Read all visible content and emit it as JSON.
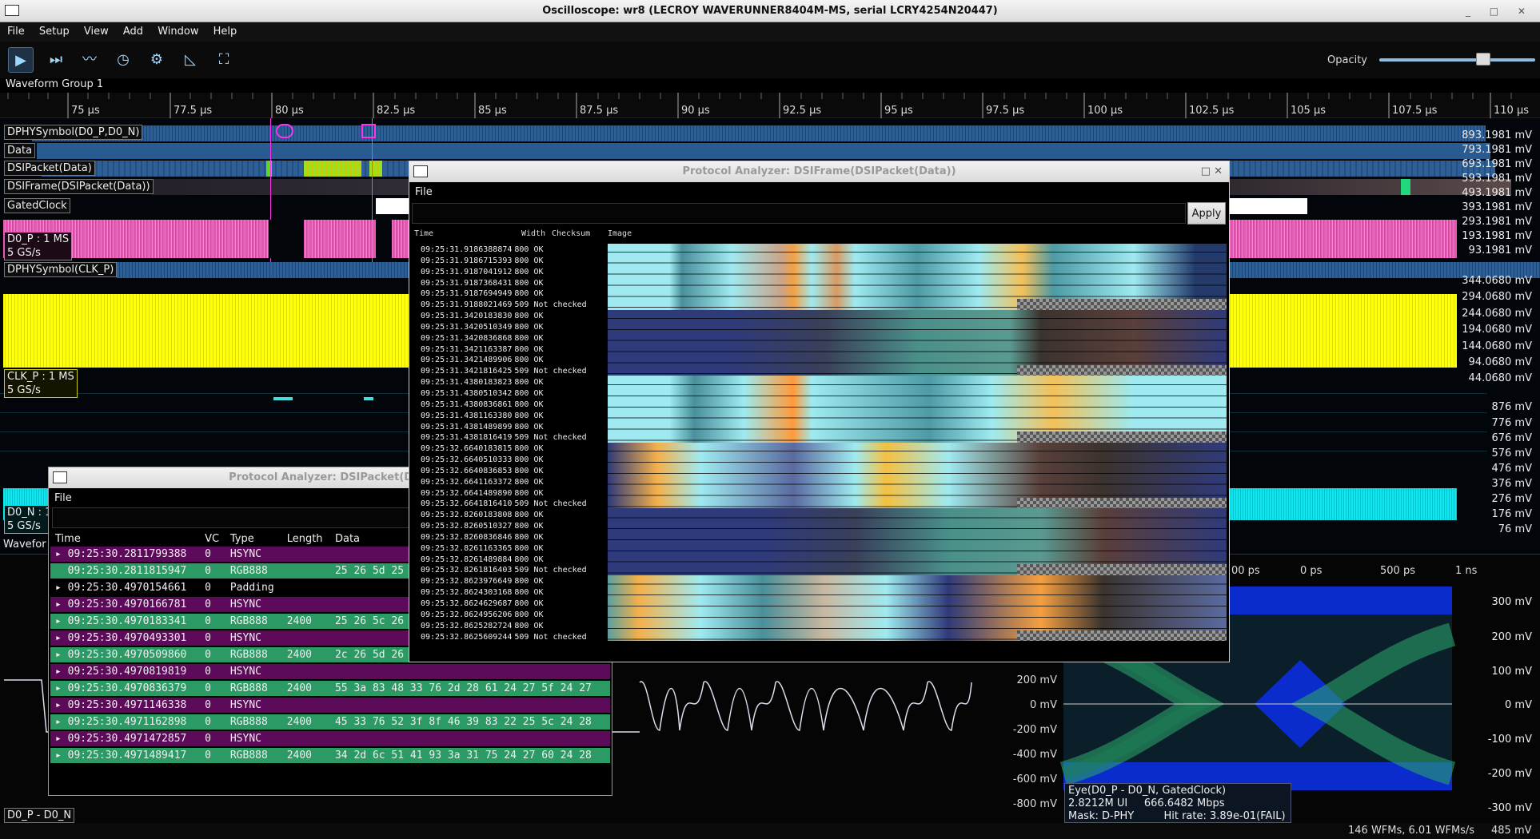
{
  "window": {
    "title": "Oscilloscope: wr8 (LECROY WAVERUNNER8404M-MS, serial LCRY4254N20447)"
  },
  "menu": [
    "File",
    "Setup",
    "View",
    "Add",
    "Window",
    "Help"
  ],
  "toolbar": {
    "buttons": [
      "play-icon",
      "step-icon",
      "waveform-icon",
      "history-icon",
      "settings-icon",
      "cursor-icon",
      "zoom-fit-icon"
    ],
    "opacity_label": "Opacity",
    "opacity_value": 0.7
  },
  "waveform_group": {
    "title": "Waveform Group 1"
  },
  "time_ruler": [
    "75 µs",
    "77.5 µs",
    "80 µs",
    "82.5 µs",
    "85 µs",
    "87.5 µs",
    "90 µs",
    "92.5 µs",
    "95 µs",
    "97.5 µs",
    "100 µs",
    "102.5 µs",
    "105 µs",
    "107.5 µs",
    "110 µs"
  ],
  "channels": {
    "dphy_symbol": "DPHYSymbol(D0_P,D0_N)",
    "data": "Data",
    "dsi_packet": "DSIPacket(Data)",
    "dsi_frame": "DSIFrame(DSIPacket(Data))",
    "gated_clock": "GatedClock",
    "d0p_line1": "D0_P : 1 MS",
    "d0p_line2": "5 GS/s",
    "dphy_clk": "DPHYSymbol(CLK_P)",
    "clkp_line1": "CLK_P : 1 MS",
    "clkp_line2": "5 GS/s",
    "d0n_line1": "D0_N : 1",
    "d0n_line2": "5 GS/s",
    "waveform_group2": "Wavefor",
    "diff": "D0_P - D0_N"
  },
  "scale_d0p": [
    "893.1981 mV",
    "793.1981 mV",
    "693.1981 mV",
    "593.1981 mV",
    "493.1981 mV",
    "393.1981 mV",
    "293.1981 mV",
    "193.1981 mV",
    "93.1981 mV"
  ],
  "scale_clkp": [
    "344.0680 mV",
    "294.0680 mV",
    "244.0680 mV",
    "194.0680 mV",
    "144.0680 mV",
    "94.0680 mV",
    "44.0680 mV"
  ],
  "scale_d0n": [
    "876 mV",
    "776 mV",
    "676 mV",
    "576 mV",
    "476 mV",
    "376 mV",
    "276 mV",
    "176 mV",
    "76 mV"
  ],
  "scale_diff": [
    "200 mV",
    "0 mV",
    "-200 mV",
    "-400 mV",
    "-600 mV",
    "-800 mV"
  ],
  "scale_eye": [
    "300 mV",
    "200 mV",
    "100 mV",
    "0 mV",
    "-100 mV",
    "-200 mV",
    "-300 mV"
  ],
  "eye_ruler": [
    "00 ps",
    "0 ps",
    "500 ps",
    "1 ns"
  ],
  "eye": {
    "title": "Eye(D0_P - D0_N, GatedClock)",
    "ui": "2.8212M UI",
    "rate": "666.6482 Mbps",
    "mask": "Mask: D-PHY",
    "hit_rate": "Hit rate: 3.89e-01(FAIL)"
  },
  "status": {
    "wfms": "146 WFMs, 6.01 WFMs/s",
    "mem": "485 mV"
  },
  "frame_analyzer": {
    "title": "Protocol Analyzer: DSIFrame(DSIPacket(Data))",
    "menu": "File",
    "filter_value": "",
    "apply": "Apply",
    "columns": [
      "Time",
      "Width",
      "Checksum",
      "Image"
    ],
    "rows": [
      [
        "09:25:31.9186388874",
        "800",
        "OK"
      ],
      [
        "09:25:31.9186715393",
        "800",
        "OK"
      ],
      [
        "09:25:31.9187041912",
        "800",
        "OK"
      ],
      [
        "09:25:31.9187368431",
        "800",
        "OK"
      ],
      [
        "09:25:31.9187694949",
        "800",
        "OK"
      ],
      [
        "09:25:31.9188021469",
        "509",
        "Not checked"
      ],
      [
        "09:25:31.3420183830",
        "800",
        "OK"
      ],
      [
        "09:25:31.3420510349",
        "800",
        "OK"
      ],
      [
        "09:25:31.3420836868",
        "800",
        "OK"
      ],
      [
        "09:25:31.3421163387",
        "800",
        "OK"
      ],
      [
        "09:25:31.3421489906",
        "800",
        "OK"
      ],
      [
        "09:25:31.3421816425",
        "509",
        "Not checked"
      ],
      [
        "09:25:31.4380183823",
        "800",
        "OK"
      ],
      [
        "09:25:31.4380510342",
        "800",
        "OK"
      ],
      [
        "09:25:31.4380836861",
        "800",
        "OK"
      ],
      [
        "09:25:31.4381163380",
        "800",
        "OK"
      ],
      [
        "09:25:31.4381489899",
        "800",
        "OK"
      ],
      [
        "09:25:31.4381816419",
        "509",
        "Not checked"
      ],
      [
        "09:25:32.6640183815",
        "800",
        "OK"
      ],
      [
        "09:25:32.6640510333",
        "800",
        "OK"
      ],
      [
        "09:25:32.6640836853",
        "800",
        "OK"
      ],
      [
        "09:25:32.6641163372",
        "800",
        "OK"
      ],
      [
        "09:25:32.6641489890",
        "800",
        "OK"
      ],
      [
        "09:25:32.6641816410",
        "509",
        "Not checked"
      ],
      [
        "09:25:32.8260183808",
        "800",
        "OK"
      ],
      [
        "09:25:32.8260510327",
        "800",
        "OK"
      ],
      [
        "09:25:32.8260836846",
        "800",
        "OK"
      ],
      [
        "09:25:32.8261163365",
        "800",
        "OK"
      ],
      [
        "09:25:32.8261489884",
        "800",
        "OK"
      ],
      [
        "09:25:32.8261816403",
        "509",
        "Not checked"
      ],
      [
        "09:25:32.8623976649",
        "800",
        "OK"
      ],
      [
        "09:25:32.8624303168",
        "800",
        "OK"
      ],
      [
        "09:25:32.8624629687",
        "800",
        "OK"
      ],
      [
        "09:25:32.8624956206",
        "800",
        "OK"
      ],
      [
        "09:25:32.8625282724",
        "800",
        "OK"
      ],
      [
        "09:25:32.8625609244",
        "509",
        "Not checked"
      ]
    ]
  },
  "packet_analyzer": {
    "title": "Protocol Analyzer: DSIPacket(Data",
    "menu": "File",
    "columns": [
      "Time",
      "VC",
      "Type",
      "Length",
      "Data"
    ],
    "rows": [
      {
        "time": "09:25:30.2811799388",
        "vc": "0",
        "type": "HSYNC",
        "length": "",
        "data": "",
        "kind": "hsync",
        "exp": true
      },
      {
        "time": "09:25:30.2811815947",
        "vc": "0",
        "type": "RGB888",
        "length": "",
        "data": "25 26 5d 25",
        "kind": "rgb",
        "exp": false
      },
      {
        "time": "09:25:30.4970154661",
        "vc": "0",
        "type": "Padding",
        "length": "",
        "data": "",
        "kind": "pad",
        "exp": true
      },
      {
        "time": "09:25:30.4970166781",
        "vc": "0",
        "type": "HSYNC",
        "length": "",
        "data": "",
        "kind": "hsync",
        "exp": true
      },
      {
        "time": "09:25:30.4970183341",
        "vc": "0",
        "type": "RGB888",
        "length": "2400",
        "data": "25 26 5c 26",
        "kind": "rgb",
        "exp": true
      },
      {
        "time": "09:25:30.4970493301",
        "vc": "0",
        "type": "HSYNC",
        "length": "",
        "data": "",
        "kind": "hsync",
        "exp": true
      },
      {
        "time": "09:25:30.4970509860",
        "vc": "0",
        "type": "RGB888",
        "length": "2400",
        "data": "2c 26 5d 26 25 35 27 25 35 26 24 38 25 26",
        "kind": "rgb",
        "exp": true
      },
      {
        "time": "09:25:30.4970819819",
        "vc": "0",
        "type": "HSYNC",
        "length": "",
        "data": "",
        "kind": "hsync",
        "exp": true
      },
      {
        "time": "09:25:30.4970836379",
        "vc": "0",
        "type": "RGB888",
        "length": "2400",
        "data": "55 3a 83 48 33 76 2d 28 61 24 27 5f 24 27",
        "kind": "rgb",
        "exp": true
      },
      {
        "time": "09:25:30.4971146338",
        "vc": "0",
        "type": "HSYNC",
        "length": "",
        "data": "",
        "kind": "hsync",
        "exp": true
      },
      {
        "time": "09:25:30.4971162898",
        "vc": "0",
        "type": "RGB888",
        "length": "2400",
        "data": "45 33 76 52 3f 8f 46 39 83 22 25 5c 24 28",
        "kind": "rgb",
        "exp": true
      },
      {
        "time": "09:25:30.4971472857",
        "vc": "0",
        "type": "HSYNC",
        "length": "",
        "data": "",
        "kind": "hsync",
        "exp": true
      },
      {
        "time": "09:25:30.4971489417",
        "vc": "0",
        "type": "RGB888",
        "length": "2400",
        "data": "34 2d 6c 51 41 93 3a 31 75 24 27 60 24 28",
        "kind": "rgb",
        "exp": true
      }
    ]
  }
}
